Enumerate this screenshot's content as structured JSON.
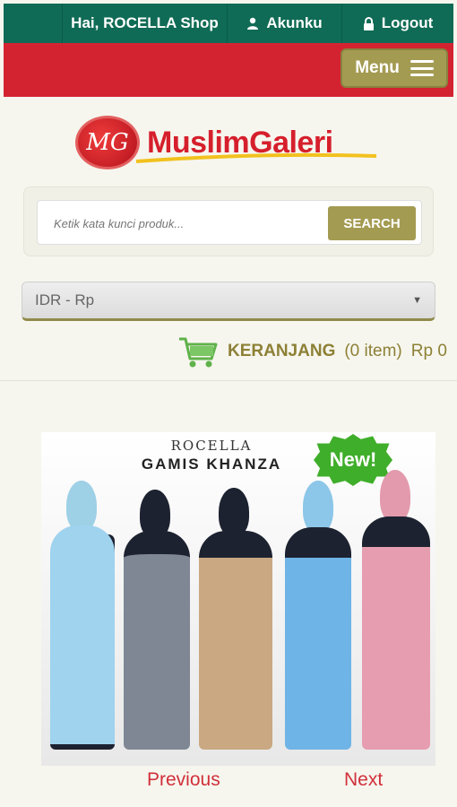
{
  "topbar": {
    "greeting": "Hai, ROCELLA Shop",
    "account_label": "Akunku",
    "logout_label": "Logout"
  },
  "nav": {
    "menu_label": "Menu"
  },
  "logo": {
    "mark": "MG",
    "text": "MuslimGaleri"
  },
  "search": {
    "placeholder": "Ketik kata kunci produk...",
    "button_label": "SEARCH"
  },
  "currency": {
    "selected": "IDR - Rp"
  },
  "cart": {
    "label": "KERANJANG",
    "count": "(0 item)",
    "total": "Rp 0"
  },
  "banner": {
    "brand": "ROCELLA",
    "product": "GAMIS KHANZA",
    "badge": "New!"
  },
  "carousel": {
    "prev_label": "Previous",
    "next_label": "Next"
  },
  "colors": {
    "topbar": "#0f6b55",
    "nav": "#d32331",
    "accent": "#a49b52",
    "link": "#d1303b"
  }
}
